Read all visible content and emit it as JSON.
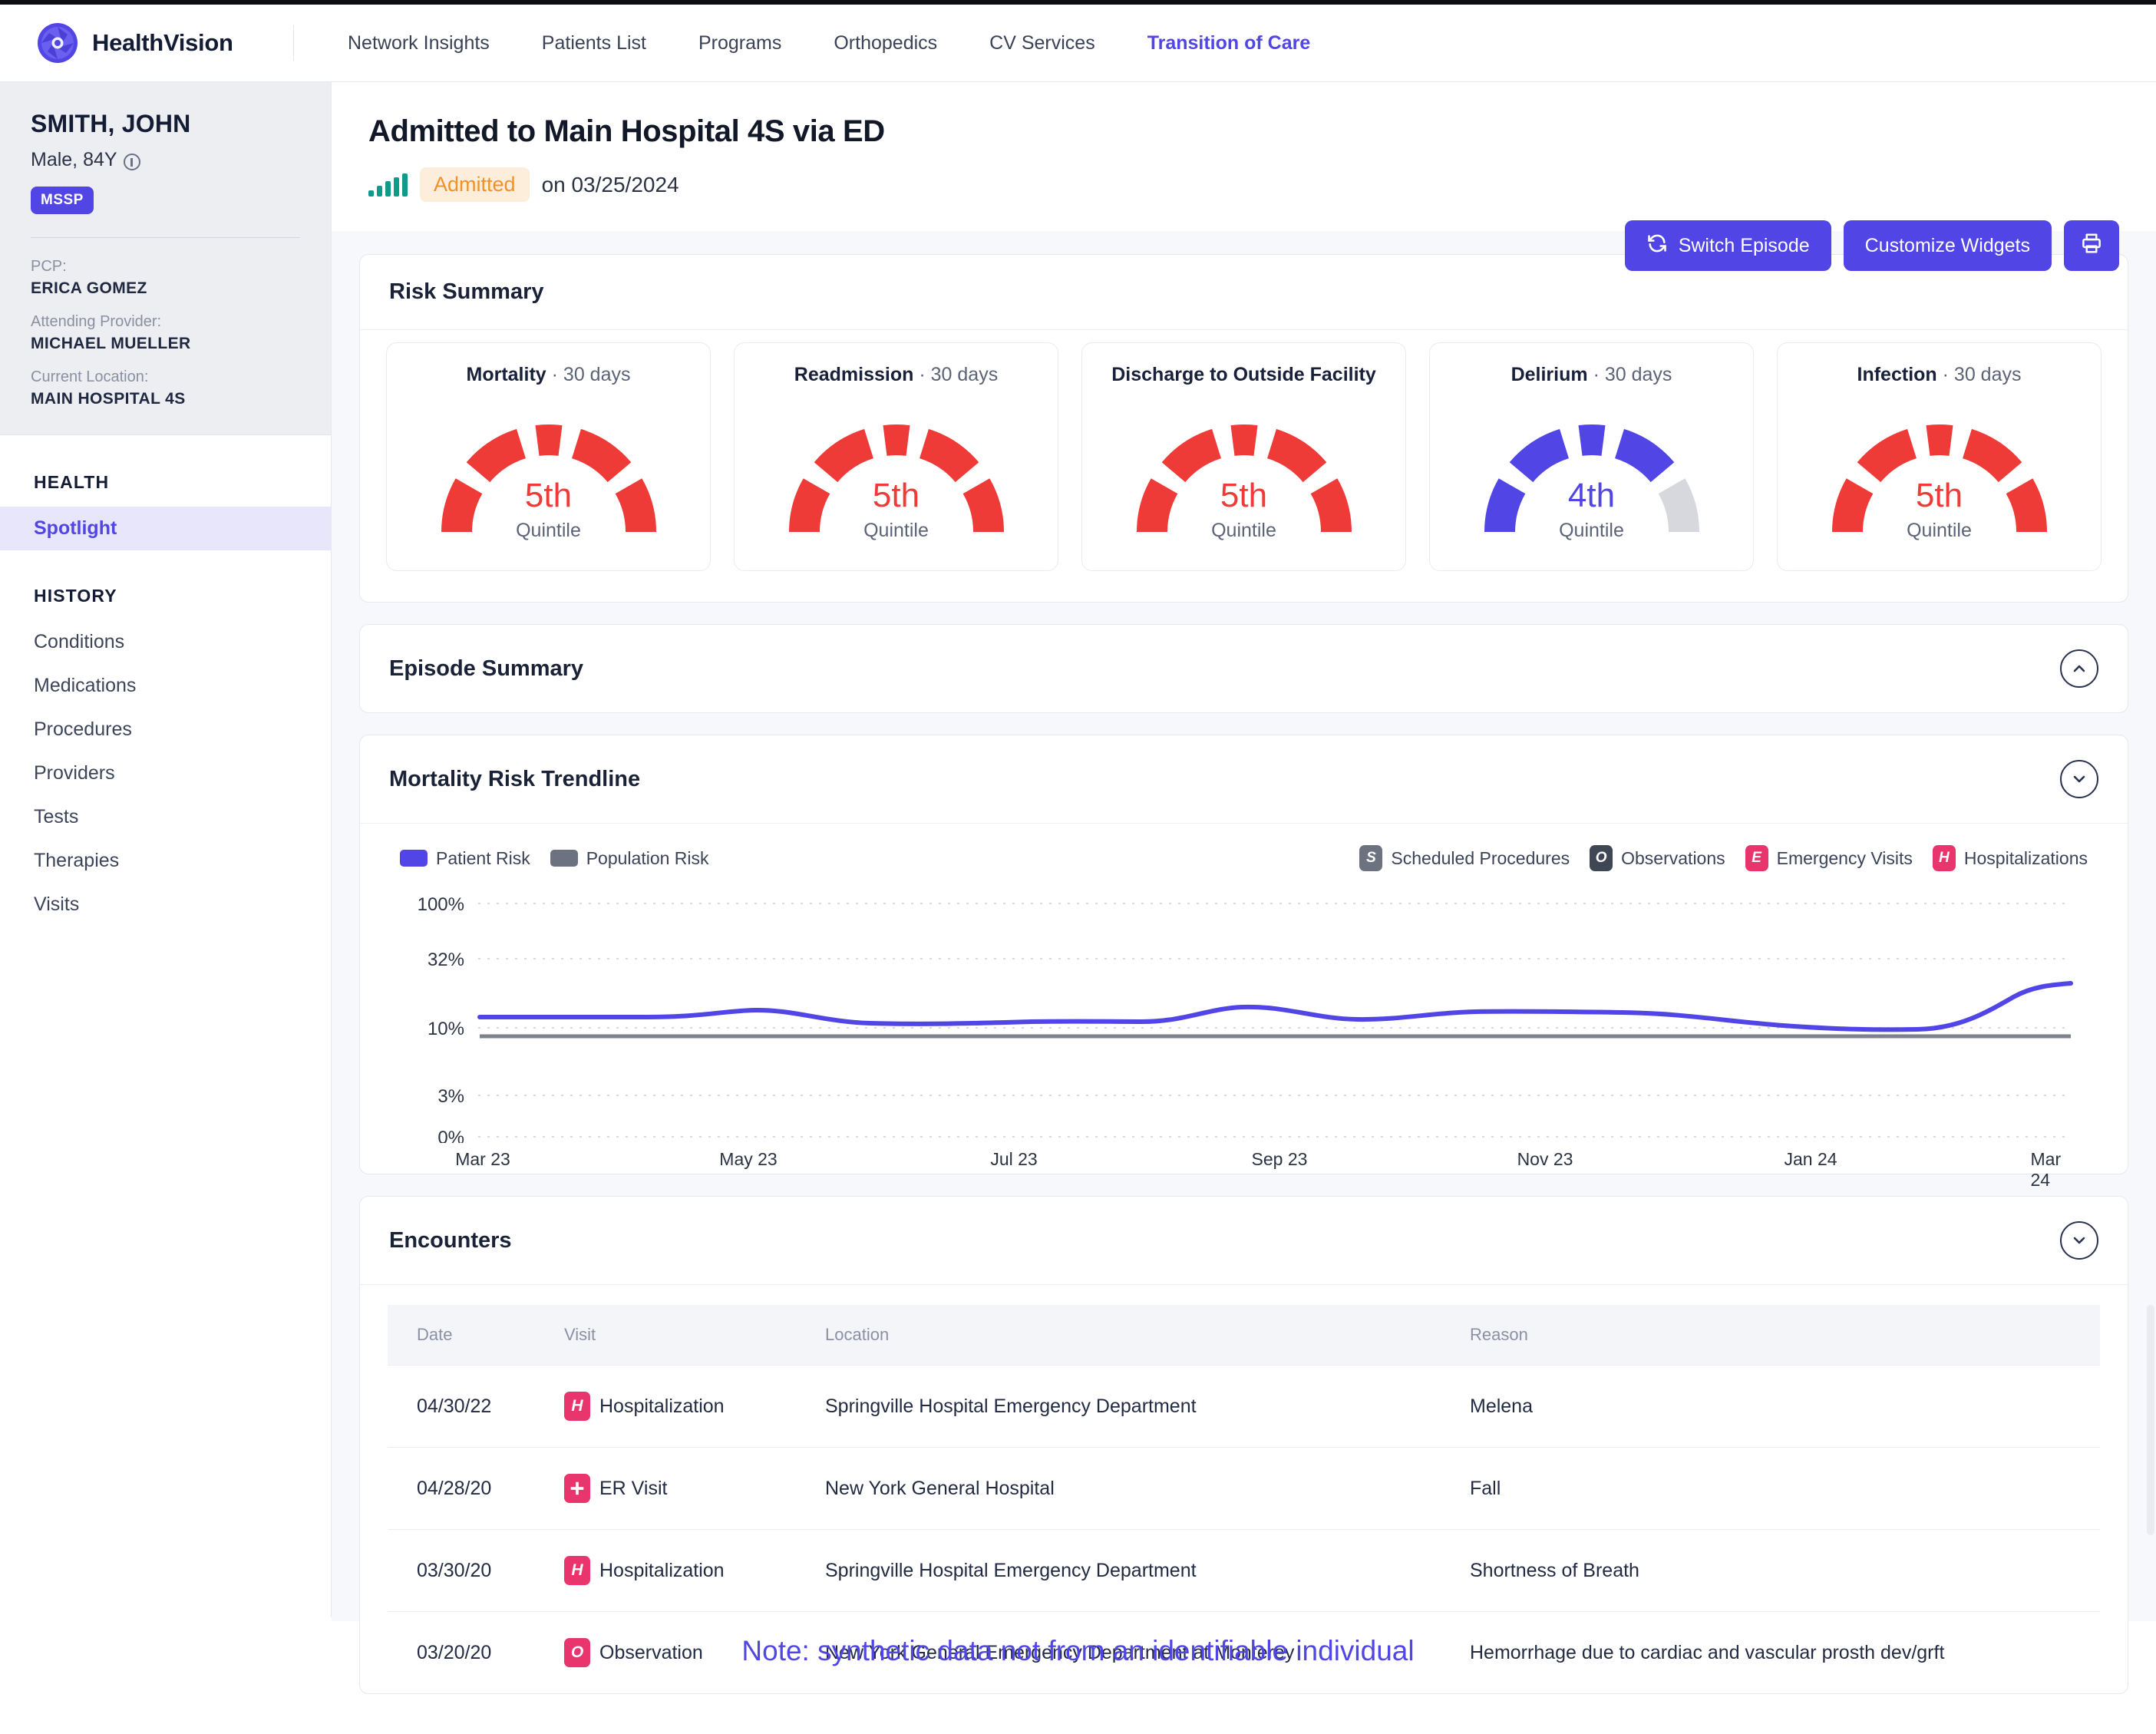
{
  "brand": {
    "name": "HealthVision",
    "logo_icon": "aperture-logo-icon"
  },
  "nav": {
    "items": [
      {
        "label": "Network Insights",
        "active": false
      },
      {
        "label": "Patients List",
        "active": false
      },
      {
        "label": "Programs",
        "active": false
      },
      {
        "label": "Orthopedics",
        "active": false
      },
      {
        "label": "CV Services",
        "active": false
      },
      {
        "label": "Transition of Care",
        "active": true
      }
    ]
  },
  "patient": {
    "name": "SMITH, JOHN",
    "demographics": "Male, 84Y",
    "info_icon": "info-icon",
    "badge": "MSSP",
    "fields": [
      {
        "label": "PCP:",
        "value": "ERICA GOMEZ"
      },
      {
        "label": "Attending Provider:",
        "value": "MICHAEL MUELLER"
      },
      {
        "label": "Current Location:",
        "value": "MAIN HOSPITAL 4S"
      }
    ]
  },
  "sidebar": {
    "sections": [
      {
        "heading": "HEALTH",
        "items": [
          {
            "label": "Spotlight",
            "active": true
          }
        ]
      },
      {
        "heading": "HISTORY",
        "items": [
          {
            "label": "Conditions",
            "active": false
          },
          {
            "label": "Medications",
            "active": false
          },
          {
            "label": "Procedures",
            "active": false
          },
          {
            "label": "Providers",
            "active": false
          },
          {
            "label": "Tests",
            "active": false
          },
          {
            "label": "Therapies",
            "active": false
          },
          {
            "label": "Visits",
            "active": false
          }
        ]
      }
    ]
  },
  "header": {
    "title": "Admitted to Main Hospital 4S via ED",
    "status": "Admitted",
    "date_text": "on 03/25/2024",
    "signal_icon": "signal-bars-icon",
    "buttons": {
      "switch_episode": "Switch Episode",
      "customize_widgets": "Customize Widgets",
      "print_icon": "printer-icon",
      "switch_icon": "refresh-icon"
    }
  },
  "risk_summary": {
    "title": "Risk Summary",
    "unit_label": "Quintile",
    "colors": {
      "high": "#ee3b38",
      "mid": "#5146e5",
      "empty": "#d6d8dd"
    },
    "gauges": [
      {
        "name": "Mortality",
        "period": "30 days",
        "value": "5th",
        "filled": 5,
        "color": "#ee3b38"
      },
      {
        "name": "Readmission",
        "period": "30 days",
        "value": "5th",
        "filled": 5,
        "color": "#ee3b38"
      },
      {
        "name": "Discharge to Outside Facility",
        "period": "30 days",
        "value": "5th",
        "filled": 5,
        "color": "#ee3b38"
      },
      {
        "name": "Delirium",
        "period": "30 days",
        "value": "4th",
        "filled": 4,
        "color": "#5146e5"
      },
      {
        "name": "Infection",
        "period": "30 days",
        "value": "5th",
        "filled": 5,
        "color": "#ee3b38"
      }
    ]
  },
  "episode_summary": {
    "title": "Episode Summary",
    "collapse_icon": "chevron-up-icon"
  },
  "trendline": {
    "title": "Mortality Risk Trendline",
    "collapse_icon": "chevron-down-icon",
    "legend_series": [
      {
        "label": "Patient Risk",
        "color": "#5146e5"
      },
      {
        "label": "Population Risk",
        "color": "#6d7280"
      }
    ],
    "legend_events": [
      {
        "label": "Scheduled Procedures",
        "letter": "S",
        "color": "#6d7280"
      },
      {
        "label": "Observations",
        "letter": "O",
        "color": "#3f4654"
      },
      {
        "label": "Emergency Visits",
        "letter": "E",
        "color": "#e9356e"
      },
      {
        "label": "Hospitalizations",
        "letter": "H",
        "color": "#e9356e"
      }
    ]
  },
  "chart_data": {
    "type": "line",
    "title": "Mortality Risk Trendline",
    "xlabel": "",
    "ylabel": "",
    "scale": "log",
    "grid": true,
    "legend_position": "top",
    "ytick_labels": [
      "100%",
      "32%",
      "10%",
      "3%",
      "0%"
    ],
    "ytick_values": [
      100,
      32,
      10,
      3,
      0
    ],
    "x": [
      "Mar 23",
      "May 23",
      "Jul 23",
      "Sep 23",
      "Nov 23",
      "Jan 24",
      "Mar 24"
    ],
    "xtick_labels": [
      "Mar 23",
      "May 23",
      "Jul 23",
      "Sep 23",
      "Nov 23",
      "Jan 24",
      "Mar 24"
    ],
    "series": [
      {
        "name": "Patient Risk",
        "color": "#5146e5",
        "months": [
          "Mar 23",
          "Apr 23",
          "May 23",
          "Jun 23",
          "Jul 23",
          "Aug 23",
          "Sep 23",
          "Oct 23",
          "Nov 23",
          "Dec 23",
          "Jan 24",
          "Feb 24",
          "Mar 24"
        ],
        "values": [
          12.5,
          12.5,
          13.4,
          11.8,
          11.9,
          12.0,
          13.6,
          12.6,
          13.2,
          13.2,
          12.2,
          11.8,
          15.8
        ]
      },
      {
        "name": "Population Risk",
        "color": "#6d7280",
        "months": [
          "Mar 23",
          "Apr 23",
          "May 23",
          "Jun 23",
          "Jul 23",
          "Aug 23",
          "Sep 23",
          "Oct 23",
          "Nov 23",
          "Dec 23",
          "Jan 24",
          "Feb 24",
          "Mar 24"
        ],
        "values": [
          9.4,
          9.4,
          9.4,
          9.4,
          9.4,
          9.4,
          9.4,
          9.4,
          9.4,
          9.4,
          9.4,
          9.4,
          9.4
        ]
      }
    ]
  },
  "encounters": {
    "title": "Encounters",
    "collapse_icon": "chevron-down-icon",
    "columns": [
      "Date",
      "Visit",
      "Location",
      "Reason"
    ],
    "rows": [
      {
        "date": "04/30/22",
        "visit": "Hospitalization",
        "visit_letter": "H",
        "visit_color": "#e9356e",
        "location": "Springville Hospital Emergency Department",
        "reason": "Melena"
      },
      {
        "date": "04/28/20",
        "visit": "ER Visit",
        "visit_letter": "+",
        "visit_color": "#e9356e",
        "location": "New York General Hospital",
        "reason": "Fall"
      },
      {
        "date": "03/30/20",
        "visit": "Hospitalization",
        "visit_letter": "H",
        "visit_color": "#e9356e",
        "location": "Springville Hospital Emergency Department",
        "reason": "Shortness of Breath"
      },
      {
        "date": "03/20/20",
        "visit": "Observation",
        "visit_letter": "O",
        "visit_color": "#e9356e",
        "location": "New York General Emergency Department at Monterey",
        "reason": "Hemorrhage due to cardiac and vascular prosth dev/grft"
      }
    ]
  },
  "footer": {
    "note": "Note: synthetic data not from an identifiable individual"
  }
}
